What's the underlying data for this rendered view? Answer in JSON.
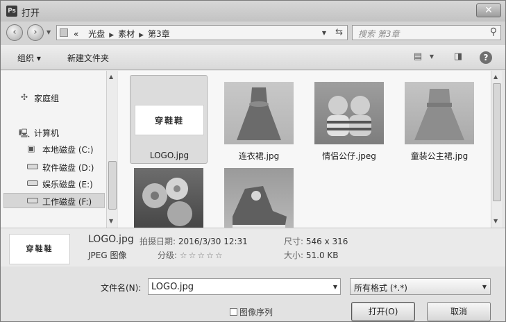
{
  "window": {
    "title": "打开",
    "app_icon": "Ps"
  },
  "address": {
    "crumb_prefix": "«",
    "crumbs": [
      "光盘",
      "素材",
      "第3章"
    ],
    "search_placeholder": "搜索 第3章"
  },
  "toolbar": {
    "organize": "组织 ▾",
    "new_folder": "新建文件夹"
  },
  "nav": {
    "items": [
      {
        "label": "家庭组"
      },
      {
        "label": "计算机"
      },
      {
        "label": "本地磁盘 (C:)"
      },
      {
        "label": "软件磁盘 (D:)"
      },
      {
        "label": "娱乐磁盘 (E:)"
      },
      {
        "label": "工作磁盘 (F:)"
      }
    ],
    "selected_index": 5
  },
  "files": [
    {
      "name": "LOGO.jpg",
      "selected": true,
      "logo_text": "穿鞋鞋"
    },
    {
      "name": "连衣裙.jpg"
    },
    {
      "name": "情侣公仔.jpeg"
    },
    {
      "name": "童装公主裙.jpg"
    },
    {
      "name": ""
    },
    {
      "name": ""
    }
  ],
  "details": {
    "thumb_text": "穿鞋鞋",
    "name": "LOGO.jpg",
    "type": "JPEG 图像",
    "date_label": "拍摄日期:",
    "date_value": "2016/3/30 12:31",
    "rating_label": "分级:",
    "rating_stars": "☆☆☆☆☆",
    "size_dim_label": "尺寸:",
    "size_dim_value": "546 x 316",
    "size_label": "大小:",
    "size_value": "51.0 KB"
  },
  "bottom": {
    "filename_label": "文件名(N):",
    "filename_value": "LOGO.jpg",
    "filetype_value": "所有格式 (*.*)",
    "sequence_label": "图像序列",
    "open_button": "打开(O)",
    "cancel_button": "取消"
  },
  "colors": {
    "window_bg": "#e6e6e6",
    "selected_tile": "#dcdcdc"
  }
}
